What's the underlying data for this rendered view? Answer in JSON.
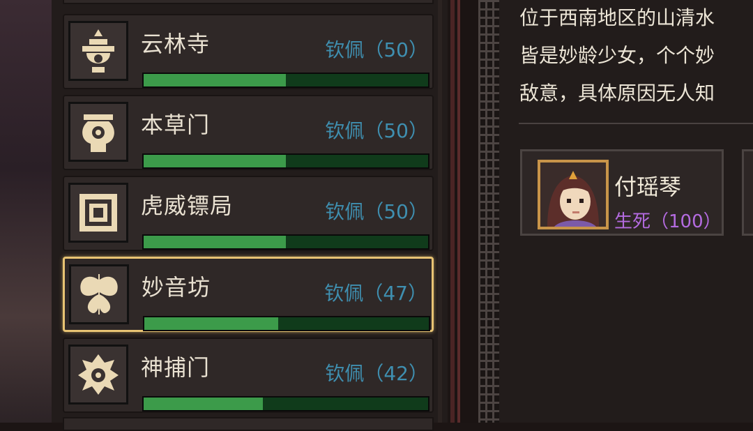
{
  "factions": [
    {
      "name": "云林寺",
      "status": "钦佩（50）",
      "value": 50,
      "icon": "temple-emblem-icon"
    },
    {
      "name": "本草门",
      "status": "钦佩（50）",
      "value": 50,
      "icon": "herb-cauldron-emblem-icon"
    },
    {
      "name": "虎威镖局",
      "status": "钦佩（50）",
      "value": 50,
      "icon": "tiger-seal-emblem-icon"
    },
    {
      "name": "妙音坊",
      "status": "钦佩（47）",
      "value": 47,
      "icon": "moth-emblem-icon"
    },
    {
      "name": "神捕门",
      "status": "钦佩（42）",
      "value": 42,
      "icon": "dragon-emblem-icon"
    }
  ],
  "detail": {
    "desc_lines": [
      "位于西南地区的山清水",
      "皆是妙龄少女，个个妙",
      "敌意，具体原因无人知"
    ],
    "member": {
      "name": "付瑶琴",
      "relation": "生死（100）",
      "icon": "member-portrait"
    }
  },
  "colors": {
    "bar_fill": "#3c9b4a",
    "bar_track": "#103b1b",
    "status": "#3f8fb0",
    "selected_border": "#e8c373",
    "relation": "#b46be0"
  }
}
